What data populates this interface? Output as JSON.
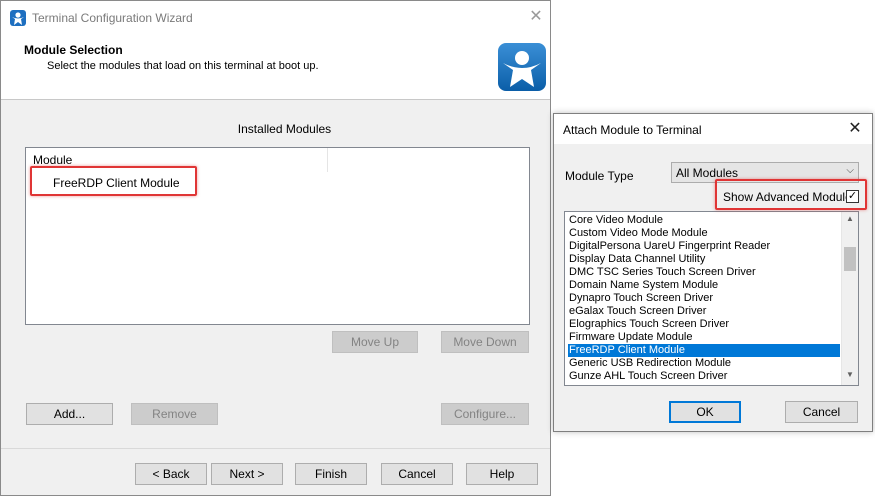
{
  "wizard": {
    "title": "Terminal Configuration Wizard",
    "heading": "Module Selection",
    "subheading": "Select the modules that load on this terminal at boot up.",
    "installed_label": "Installed Modules",
    "column_header": "Module",
    "installed_modules": [
      "FreeRDP Client Module"
    ],
    "buttons": {
      "move_up": "Move Up",
      "move_down": "Move Down",
      "add": "Add...",
      "remove": "Remove",
      "configure": "Configure...",
      "back": "< Back",
      "next": "Next >",
      "finish": "Finish",
      "cancel": "Cancel",
      "help": "Help"
    }
  },
  "attach_dialog": {
    "title": "Attach Module to Terminal",
    "module_type_label": "Module Type",
    "module_type_value": "All Modules",
    "show_advanced_label": "Show Advanced Modules",
    "show_advanced_checked": true,
    "modules": [
      "Core Video Module",
      "Custom Video Mode Module",
      "DigitalPersona UareU Fingerprint Reader",
      "Display Data Channel Utility",
      "DMC TSC Series Touch Screen Driver",
      "Domain Name System Module",
      "Dynapro Touch Screen Driver",
      "eGalax Touch Screen Driver",
      "Elographics Touch Screen Driver",
      "Firmware Update Module",
      "FreeRDP Client Module",
      "Generic USB Redirection Module",
      "Gunze AHL Touch Screen Driver"
    ],
    "selected_module": "FreeRDP Client Module",
    "ok_label": "OK",
    "cancel_label": "Cancel"
  },
  "icons": {
    "app": "thinmanager-icon",
    "logo": "thinmanager-logo",
    "close": "close-icon",
    "dropdown": "chevron-down-icon",
    "check": "checkmark-icon"
  },
  "colors": {
    "highlight": "#e03535",
    "selection": "#0078d7",
    "logo": "#0b5ea8"
  }
}
